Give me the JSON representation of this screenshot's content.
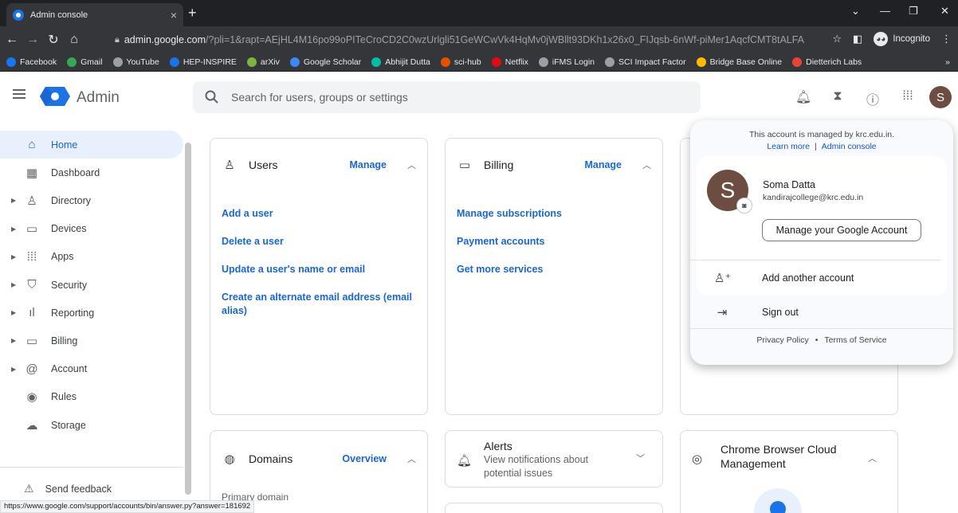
{
  "browser": {
    "tab_title": "Admin console",
    "tab_close": "×",
    "new_tab": "+",
    "url_host": "admin.google.com",
    "url_path": "/?pli=1&rapt=AEjHL4M16po99oPITeCroCD2C0wzUrlgli51GeWCwVk4HqMv0jWBllt93DKh1x26x0_FIJqsb-6nWf-piMer1AqcfCMT8tALFA",
    "incognito_label": "Incognito",
    "bookmarks": [
      {
        "label": "Facebook",
        "color": "#1877f2"
      },
      {
        "label": "Gmail",
        "color": "#34a853"
      },
      {
        "label": "YouTube",
        "color": "#9aa0a6"
      },
      {
        "label": "HEP-INSPIRE",
        "color": "#1a73e8"
      },
      {
        "label": "arXiv",
        "color": "#7cb342"
      },
      {
        "label": "Google Scholar",
        "color": "#4285f4"
      },
      {
        "label": "Abhijit Dutta",
        "color": "#00bfa5"
      },
      {
        "label": "sci-hub",
        "color": "#e65100"
      },
      {
        "label": "Netflix",
        "color": "#e50914"
      },
      {
        "label": "iFMS Login",
        "color": "#9aa0a6"
      },
      {
        "label": "SCI Impact Factor",
        "color": "#9aa0a6"
      },
      {
        "label": "Bridge Base Online",
        "color": "#fbbc04"
      },
      {
        "label": "Dietterich Labs",
        "color": "#ea4335"
      }
    ],
    "bookmarks_overflow": "»",
    "status_url": "https://www.google.com/support/accounts/bin/answer.py?answer=181692"
  },
  "header": {
    "brand": "Admin",
    "search_placeholder": "Search for users, groups or settings",
    "avatar_initial": "S"
  },
  "sidebar": {
    "items": [
      {
        "label": "Home",
        "icon": "home-icon",
        "glyph": "⌂",
        "expandable": false,
        "active": true
      },
      {
        "label": "Dashboard",
        "icon": "dashboard-icon",
        "glyph": "▦",
        "expandable": false,
        "active": false
      },
      {
        "label": "Directory",
        "icon": "person-icon",
        "glyph": "♙",
        "expandable": true,
        "active": false
      },
      {
        "label": "Devices",
        "icon": "devices-icon",
        "glyph": "▭",
        "expandable": true,
        "active": false
      },
      {
        "label": "Apps",
        "icon": "apps-grid-icon",
        "glyph": "⁞⁞⁞",
        "expandable": true,
        "active": false
      },
      {
        "label": "Security",
        "icon": "shield-icon",
        "glyph": "⛉",
        "expandable": true,
        "active": false
      },
      {
        "label": "Reporting",
        "icon": "bar-chart-icon",
        "glyph": "ıl",
        "expandable": true,
        "active": false
      },
      {
        "label": "Billing",
        "icon": "credit-card-icon",
        "glyph": "▭",
        "expandable": true,
        "active": false
      },
      {
        "label": "Account",
        "icon": "at-icon",
        "glyph": "@",
        "expandable": true,
        "active": false
      },
      {
        "label": "Rules",
        "icon": "rules-icon",
        "glyph": "◉",
        "expandable": false,
        "active": false
      },
      {
        "label": "Storage",
        "icon": "cloud-icon",
        "glyph": "☁",
        "expandable": false,
        "active": false
      }
    ],
    "feedback": "Send feedback"
  },
  "cards": {
    "users": {
      "title": "Users",
      "action": "Manage",
      "links": [
        "Add a user",
        "Delete a user",
        "Update a user's name or email",
        "Create an alternate email address (email alias)"
      ]
    },
    "billing": {
      "title": "Billing",
      "action": "Manage",
      "links": [
        "Manage subscriptions",
        "Payment accounts",
        "Get more services"
      ]
    },
    "domains": {
      "title": "Domains",
      "action": "Overview",
      "sub": "Primary domain"
    },
    "alerts": {
      "title": "Alerts",
      "sub": "View notifications about potential issues"
    },
    "chrome": {
      "title": "Chrome Browser Cloud Management"
    }
  },
  "account_popup": {
    "managed_text": "This account is managed by krc.edu.in.",
    "learn_more": "Learn more",
    "separator": "|",
    "admin_console": "Admin console",
    "avatar_initial": "S",
    "name": "Soma Datta",
    "email": "kandirajcollege@krc.edu.in",
    "manage_button": "Manage your Google Account",
    "add_account": "Add another account",
    "sign_out": "Sign out",
    "privacy": "Privacy Policy",
    "dot": "•",
    "terms": "Terms of Service"
  }
}
